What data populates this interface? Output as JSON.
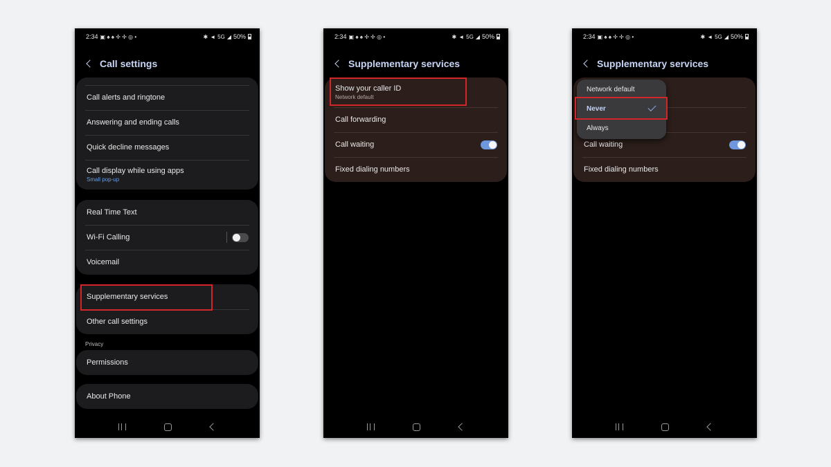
{
  "status_bar": {
    "time": "2:34",
    "network": "5G",
    "battery": "50%"
  },
  "phone1": {
    "title": "Call settings",
    "group1": [
      {
        "label": "Call alerts and ringtone"
      },
      {
        "label": "Answering and ending calls"
      },
      {
        "label": "Quick decline messages"
      },
      {
        "label": "Call display while using apps",
        "sub": "Small pop-up"
      }
    ],
    "group2": [
      {
        "label": "Real Time Text"
      },
      {
        "label": "Wi-Fi Calling",
        "toggle": "off"
      },
      {
        "label": "Voicemail"
      }
    ],
    "group3": [
      {
        "label": "Supplementary services"
      },
      {
        "label": "Other call settings"
      }
    ],
    "privacy_label": "Privacy",
    "group4": [
      {
        "label": "Permissions"
      }
    ],
    "group5": [
      {
        "label": "About Phone"
      }
    ]
  },
  "phone2": {
    "title": "Supplementary services",
    "items": [
      {
        "label": "Show your caller ID",
        "sub": "Network default"
      },
      {
        "label": "Call forwarding"
      },
      {
        "label": "Call waiting",
        "toggle": "on"
      },
      {
        "label": "Fixed dialing numbers"
      }
    ]
  },
  "phone3": {
    "title": "Supplementary services",
    "items": [
      {
        "label": "Call waiting",
        "toggle": "on"
      },
      {
        "label": "Fixed dialing numbers"
      }
    ],
    "popup_options": [
      {
        "label": "Network default"
      },
      {
        "label": "Never",
        "selected": true
      },
      {
        "label": "Always"
      }
    ]
  },
  "colors": {
    "highlight": "#d3262b",
    "accent": "#6e97dd",
    "title": "#c7d5f6"
  }
}
